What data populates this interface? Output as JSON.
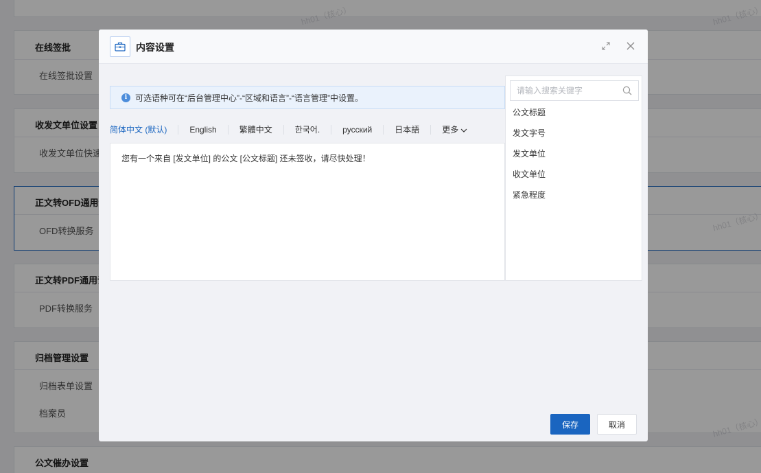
{
  "background": {
    "sections": [
      {
        "title": "在线签批",
        "items": [
          "在线签批设置"
        ]
      },
      {
        "title": "收发文单位设置",
        "items": [
          "收发文单位快速"
        ]
      },
      {
        "title": "正文转OFD通用设",
        "items": [
          "OFD转换服务"
        ]
      },
      {
        "title": "正文转PDF通用设",
        "items": [
          "PDF转换服务"
        ]
      },
      {
        "title": "归档管理设置",
        "items": [
          "归档表单设置",
          "档案员"
        ]
      },
      {
        "title": "公文催办设置",
        "items": []
      }
    ],
    "watermark": "hh01（核心）"
  },
  "modal": {
    "title": "内容设置",
    "info": "可选语种可在“后台管理中心”-“区域和语言”-“语言管理”中设置。",
    "tabs": [
      "简体中文 (默认)",
      "English",
      "繁體中文",
      "한국어.",
      "русский",
      "日本語",
      "更多"
    ],
    "active_tab": 0,
    "editor_text": "您有一个来自 [发文单位] 的公文 [公文标题] 还未签收，请尽快处理！",
    "search_placeholder": "请输入搜索关键字",
    "fields": [
      "公文标题",
      "发文字号",
      "发文单位",
      "收文单位",
      "紧急程度"
    ],
    "save_label": "保存",
    "cancel_label": "取消"
  },
  "colors": {
    "primary": "#1a65c0",
    "info_bg": "#eaf2fc",
    "modal_bg": "#f1f2f6"
  }
}
